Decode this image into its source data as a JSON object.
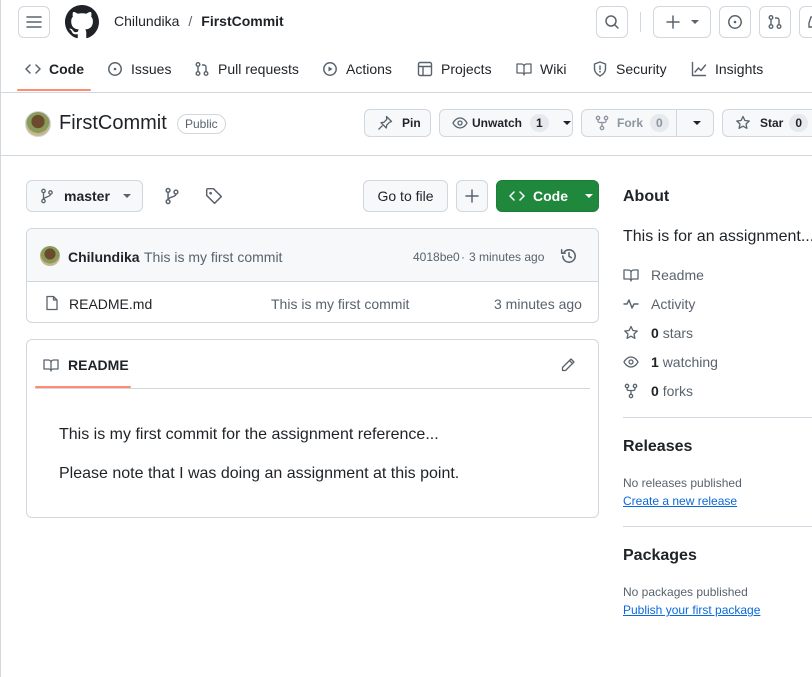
{
  "header": {
    "owner": "Chilundika",
    "separator": "/",
    "repo": "FirstCommit"
  },
  "tabs": [
    {
      "label": "Code"
    },
    {
      "label": "Issues"
    },
    {
      "label": "Pull requests"
    },
    {
      "label": "Actions"
    },
    {
      "label": "Projects"
    },
    {
      "label": "Wiki"
    },
    {
      "label": "Security"
    },
    {
      "label": "Insights"
    }
  ],
  "repo_header": {
    "title": "FirstCommit",
    "visibility": "Public",
    "pin_label": "Pin",
    "unwatch_label": "Unwatch",
    "watch_count": "1",
    "fork_label": "Fork",
    "fork_count": "0",
    "star_label": "Star",
    "star_count": "0"
  },
  "toolbar": {
    "branch": "master",
    "go_to_file": "Go to file",
    "code_label": "Code"
  },
  "commit": {
    "author": "Chilundika",
    "message": "This is my first commit",
    "hash": "4018be0",
    "dot": "·",
    "time": "3 minutes ago"
  },
  "files": [
    {
      "name": "README.md",
      "message": "This is my first commit",
      "time": "3 minutes ago"
    }
  ],
  "readme": {
    "tab_label": "README",
    "paragraphs": [
      "This is my first commit for the assignment reference...",
      "Please note that I was doing an assignment at this point."
    ]
  },
  "about": {
    "heading": "About",
    "description": "This is for an assignment...",
    "readme": "Readme",
    "activity": "Activity",
    "stars_count": "0",
    "stars_label": "stars",
    "watching_count": "1",
    "watching_label": "watching",
    "forks_count": "0",
    "forks_label": "forks"
  },
  "releases": {
    "heading": "Releases",
    "none": "No releases published",
    "create_link": "Create a new release"
  },
  "packages": {
    "heading": "Packages",
    "none": "No packages published",
    "publish_link": "Publish your first package"
  },
  "colors": {
    "accent_underline": "#fd8c73",
    "code_button": "#1f883d",
    "link": "#0969da"
  }
}
